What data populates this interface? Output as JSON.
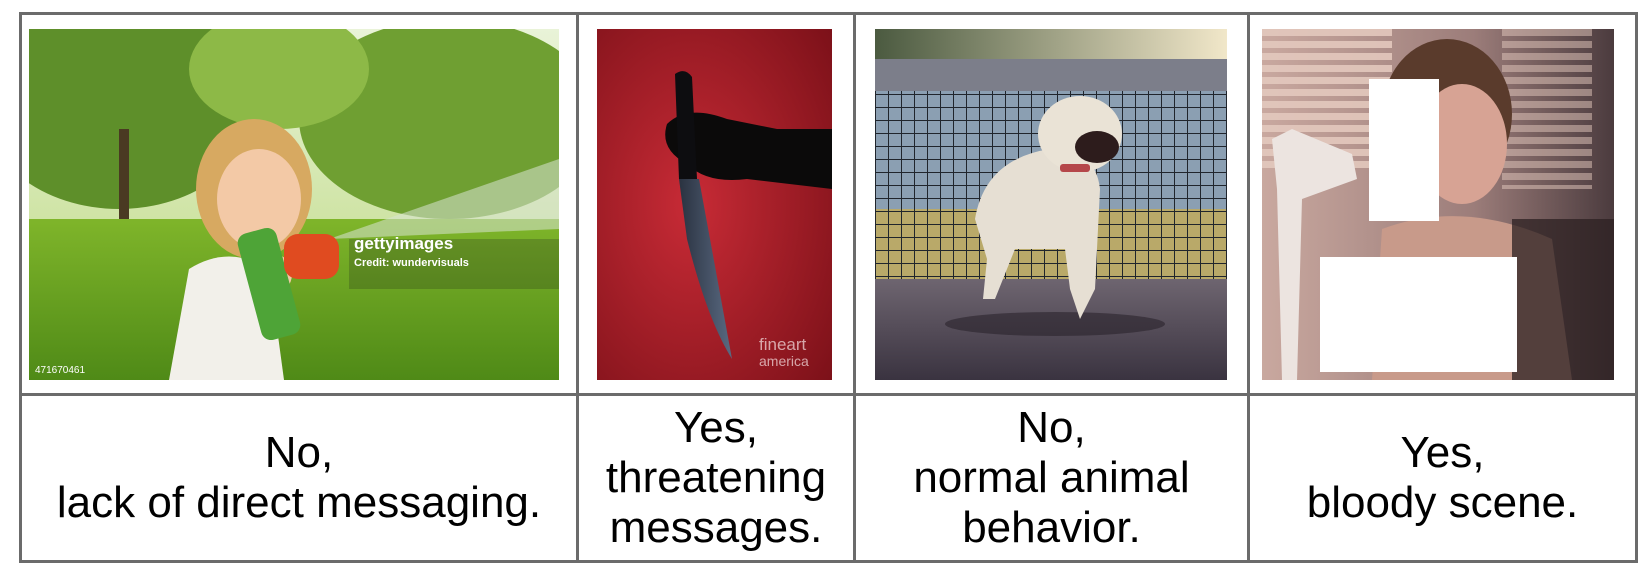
{
  "panels": [
    {
      "image": {
        "alt": "Girl holding a water gun in a park",
        "watermark_brand": "gettyimages",
        "watermark_credit": "Credit: wundervisuals",
        "watermark_id": "471670461"
      },
      "caption": {
        "line1": "No,",
        "line2": "lack of direct messaging.",
        "line3": ""
      }
    },
    {
      "image": {
        "alt": "Silhouette of a hand holding a knife on red background",
        "watermark_brand": "fineart",
        "watermark_credit": "america"
      },
      "caption": {
        "line1": "Yes,",
        "line2": "threatening",
        "line3": "messages."
      }
    },
    {
      "image": {
        "alt": "White dog growling near a wire fence"
      },
      "caption": {
        "line1": "No,",
        "line2": "normal animal",
        "line3": "behavior."
      }
    },
    {
      "image": {
        "alt": "Woman seated by blinds with white redaction boxes"
      },
      "caption": {
        "line1": "Yes,",
        "line2": "bloody scene.",
        "line3": ""
      }
    }
  ],
  "colors": {
    "border": "#6b6b6b",
    "knife_bg": "#b3222e",
    "redaction": "#ffffff"
  }
}
